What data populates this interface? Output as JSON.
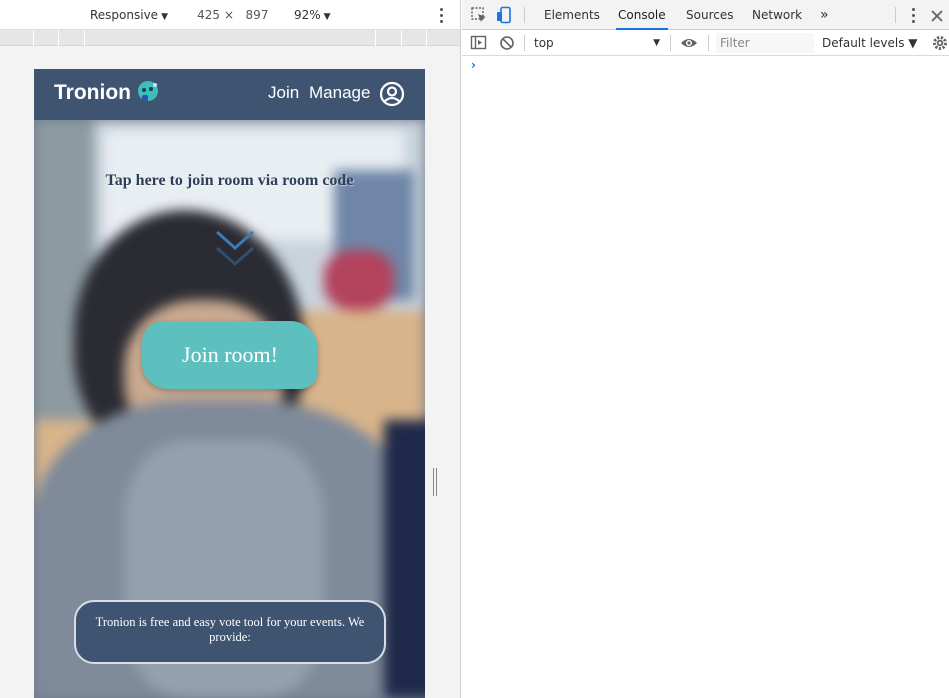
{
  "device_toolbar": {
    "device": "Responsive",
    "width": "425",
    "times": "×",
    "height": "897",
    "zoom": "92%",
    "caret": "▼"
  },
  "page": {
    "brand": "Tronion",
    "nav": {
      "join": "Join",
      "manage": "Manage"
    },
    "join_hint": "Tap here to join room via room code",
    "join_button": "Join room!",
    "info_text": "Tronion is free and easy vote tool for your events. We provide:",
    "colors": {
      "navbar": "#3f5471",
      "accent": "#5dc0be"
    }
  },
  "devtools": {
    "tabs": [
      {
        "label": "Elements",
        "active": false
      },
      {
        "label": "Console",
        "active": true
      },
      {
        "label": "Sources",
        "active": false
      },
      {
        "label": "Network",
        "active": false
      }
    ],
    "more_tabs": "»",
    "context": "top",
    "filter_placeholder": "Filter",
    "levels": "Default levels ▼",
    "prompt": "›",
    "active_tab_color": "#1a73e8"
  }
}
